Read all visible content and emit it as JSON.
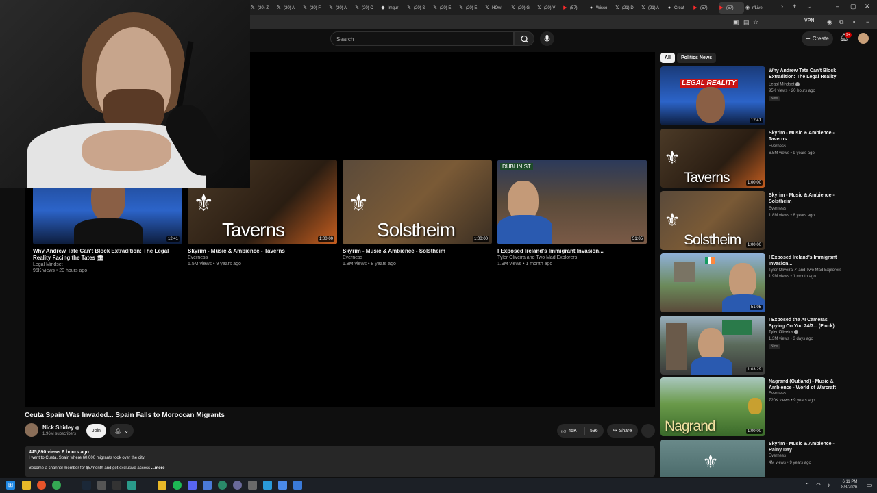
{
  "browser": {
    "tabs": [
      {
        "label": "(20) Z",
        "icon": "x-logo"
      },
      {
        "label": "(20) A",
        "icon": "x-logo"
      },
      {
        "label": "(20) F",
        "icon": "x-logo"
      },
      {
        "label": "(20) A",
        "icon": "x-logo"
      },
      {
        "label": "(20) C",
        "icon": "x-logo"
      },
      {
        "label": "Imgur",
        "icon": "imgur-logo"
      },
      {
        "label": "(20) S",
        "icon": "x-logo"
      },
      {
        "label": "(20) E",
        "icon": "x-logo"
      },
      {
        "label": "(20) E",
        "icon": "x-logo"
      },
      {
        "label": "HOw!",
        "icon": "x-logo"
      },
      {
        "label": "(20) G",
        "icon": "x-logo"
      },
      {
        "label": "(20) V",
        "icon": "x-logo"
      },
      {
        "label": "(57)",
        "icon": "youtube-logo"
      },
      {
        "label": "Wisco",
        "icon": "site-logo"
      },
      {
        "label": "(21) D",
        "icon": "x-logo"
      },
      {
        "label": "(21) A",
        "icon": "x-logo"
      },
      {
        "label": "Creat",
        "icon": "site-logo"
      },
      {
        "label": "(57)",
        "icon": "youtube-logo"
      },
      {
        "label": "(57)",
        "icon": "youtube-logo"
      },
      {
        "label": "r/Live",
        "icon": "reddit-logo"
      }
    ],
    "vpn_label": "VPN"
  },
  "header": {
    "search_placeholder": "Search",
    "create_label": "Create",
    "notif_badge": "9+"
  },
  "end_cards": [
    {
      "title": "Why Andrew Tate Can't Block Extradition: The Legal Reality Facing the Tates 🏛",
      "channel": "Legal Mindset",
      "meta": "95K views • 20 hours ago",
      "duration": "12:41",
      "thumb_text": ""
    },
    {
      "title": "Skyrim - Music & Ambience - Taverns",
      "channel": "Everness",
      "meta": "6.5M views • 9 years ago",
      "duration": "1:00:00",
      "thumb_text": "Taverns"
    },
    {
      "title": "Skyrim - Music & Ambience - Solstheim",
      "channel": "Everness",
      "meta": "1.8M views • 8 years ago",
      "duration": "1:00:00",
      "thumb_text": "Solstheim"
    },
    {
      "title": "I Exposed Ireland's Immigrant Invasion...",
      "channel": "Tyler Oliveira and Two Mad Explorers",
      "meta": "1.9M views • 1 month ago",
      "duration": "51:05",
      "thumb_text": "DUBLIN ST"
    }
  ],
  "video": {
    "title": "Ceuta Spain Was Invaded... Spain Falls to Moroccan Migrants",
    "channel": "Nick Shirley",
    "subs": "1.96M subscribers",
    "join": "Join",
    "likes": "45K",
    "comments": "536",
    "share": "Share",
    "stats": "445,890 views  6 hours ago",
    "desc1": "I went to Cueta, Spain where 60,000 migrants took over the city.",
    "desc2": "Become a channel member for $5/month and get exclusive access",
    "more": "...more"
  },
  "sidebar": {
    "chips": [
      "All",
      "Politics News"
    ],
    "recs": [
      {
        "title": "Why Andrew Tate Can't Block Extradition: The Legal Reality ...",
        "channel": "Legal Mindset",
        "views": "95K views • 20 hours ago",
        "badge": "New",
        "duration": "12:41",
        "thumb_text": "LEGAL REALITY"
      },
      {
        "title": "Skyrim - Music & Ambience - Taverns",
        "channel": "Everness",
        "views": "6.5M views • 9 years ago",
        "badge": "",
        "duration": "1:00:00",
        "thumb_text": "Taverns"
      },
      {
        "title": "Skyrim - Music & Ambience - Solstheim",
        "channel": "Everness",
        "views": "1.8M views • 8 years ago",
        "badge": "",
        "duration": "1:00:00",
        "thumb_text": "Solstheim"
      },
      {
        "title": "I Exposed Ireland's Immigrant Invasion...",
        "channel": "Tyler Oliveira ✓ and Two Mad Explorers",
        "views": "1.9M views • 1 month ago",
        "badge": "",
        "duration": "51:05",
        "thumb_text": ""
      },
      {
        "title": "I Exposed the AI Cameras Spying On You 24/7... (Flock)",
        "channel": "Tyler Oliveira",
        "views": "1.3M views • 3 days ago",
        "badge": "New",
        "duration": "1:03:29",
        "thumb_text": ""
      },
      {
        "title": "Nagrand (Outland) - Music & Ambience - World of Warcraft",
        "channel": "Everness",
        "views": "720K views • 9 years ago",
        "badge": "",
        "duration": "1:00:00",
        "thumb_text": "Nagrand"
      },
      {
        "title": "Skyrim - Music & Ambience - Rainy Day",
        "channel": "Everness",
        "views": "4M views • 9 years ago",
        "badge": "",
        "duration": "",
        "thumb_text": ""
      }
    ]
  },
  "taskbar": {
    "time": "6:11 PM",
    "date": "8/3/2026"
  },
  "colors": {
    "bg": "#0f0f0f",
    "surface": "#272727",
    "accent_red": "#cc0000"
  }
}
